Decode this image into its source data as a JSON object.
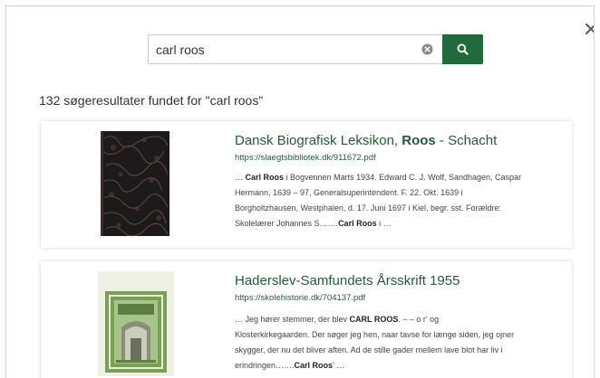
{
  "search": {
    "value": "carl roos",
    "clear_icon": "clear-circle-icon",
    "search_icon": "magnifier-icon",
    "accent": "#1f6b3b"
  },
  "close_icon": "close-x-icon",
  "results_summary": "132 søgeresultater fundet for \"carl roos\"",
  "results": [
    {
      "title_pre": "Dansk Biografisk Leksikon, ",
      "title_bold": "Roos",
      "title_post": " - Schacht",
      "url": "https://slaegtsbibliotek.dk/911672.pdf",
      "snippet_lines": [
        {
          "pre": "… ",
          "bold": "Carl Roos",
          "post": " i Bogvennen Marts 1934. Edward C. J. Wolf, Sandhagen, Caspar"
        },
        {
          "pre": "Hermann, 1639 – 97, Generalsuperintendent. F. 22. Okt. 1639 i",
          "bold": "",
          "post": ""
        },
        {
          "pre": "Borgholtzhausen, Westphalen, d. 17. Juni 1697 i Kiel, begr. sst. Forældre:",
          "bold": "",
          "post": ""
        },
        {
          "pre": "Skolelærer Johannes S…….",
          "bold": "Carl Roos",
          "post": " i …"
        }
      ]
    },
    {
      "title_pre": "Haderslev-Samfundets Årsskrift 1955",
      "title_bold": "",
      "title_post": "",
      "url": "https://skolehistorie.dk/704137.pdf",
      "snippet_lines": [
        {
          "pre": "… Jeg hører stemmer, der blev ",
          "bold": "CARL ROOS",
          "post": ". – – o r' og"
        },
        {
          "pre": "Klosterkirkegaarden. Der søger jeg hen, naar tavse for længe siden, jeg ojner",
          "bold": "",
          "post": ""
        },
        {
          "pre": "skygger, der nu det bliver aften. Ad de stille gader mellem lave blot har liv i",
          "bold": "",
          "post": ""
        },
        {
          "pre": "erindringen…….",
          "bold": "Carl Roos",
          "post": "' …"
        }
      ]
    }
  ]
}
